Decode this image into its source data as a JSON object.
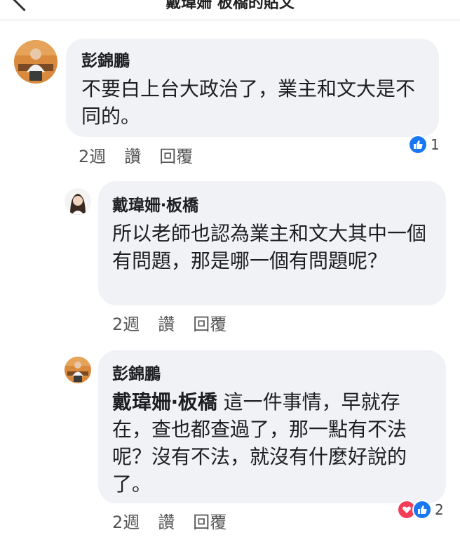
{
  "header": {
    "title": "戴瑋姍 板橋的貼文",
    "more": "···"
  },
  "comments": [
    {
      "author": "彭錦鵬",
      "text": "不要白上台大政治了，業主和文大是不同的。",
      "time": "2週",
      "like": "讚",
      "reply": "回覆",
      "reaction_count": "1",
      "reactions": [
        "like-icon"
      ]
    },
    {
      "author": "戴瑋姍‧板橋",
      "text": "所以老師也認為業主和文大其中一個有問題，那是哪一個有問題呢？",
      "time": "2週",
      "like": "讚",
      "reply": "回覆"
    },
    {
      "author": "彭錦鵬",
      "mention": "戴瑋姍‧板橋",
      "text": "這一件事情，早就存在，查也都查過了，那一點有不法呢？沒有不法，就沒有什麼好說的了。",
      "time": "2週",
      "like": "讚",
      "reply": "回覆",
      "reaction_count": "2",
      "reactions": [
        "heart-icon",
        "like-icon"
      ]
    }
  ],
  "colors": {
    "bubble": "#f0f2f5",
    "like": "#1877f2",
    "love": "#f33e58"
  }
}
